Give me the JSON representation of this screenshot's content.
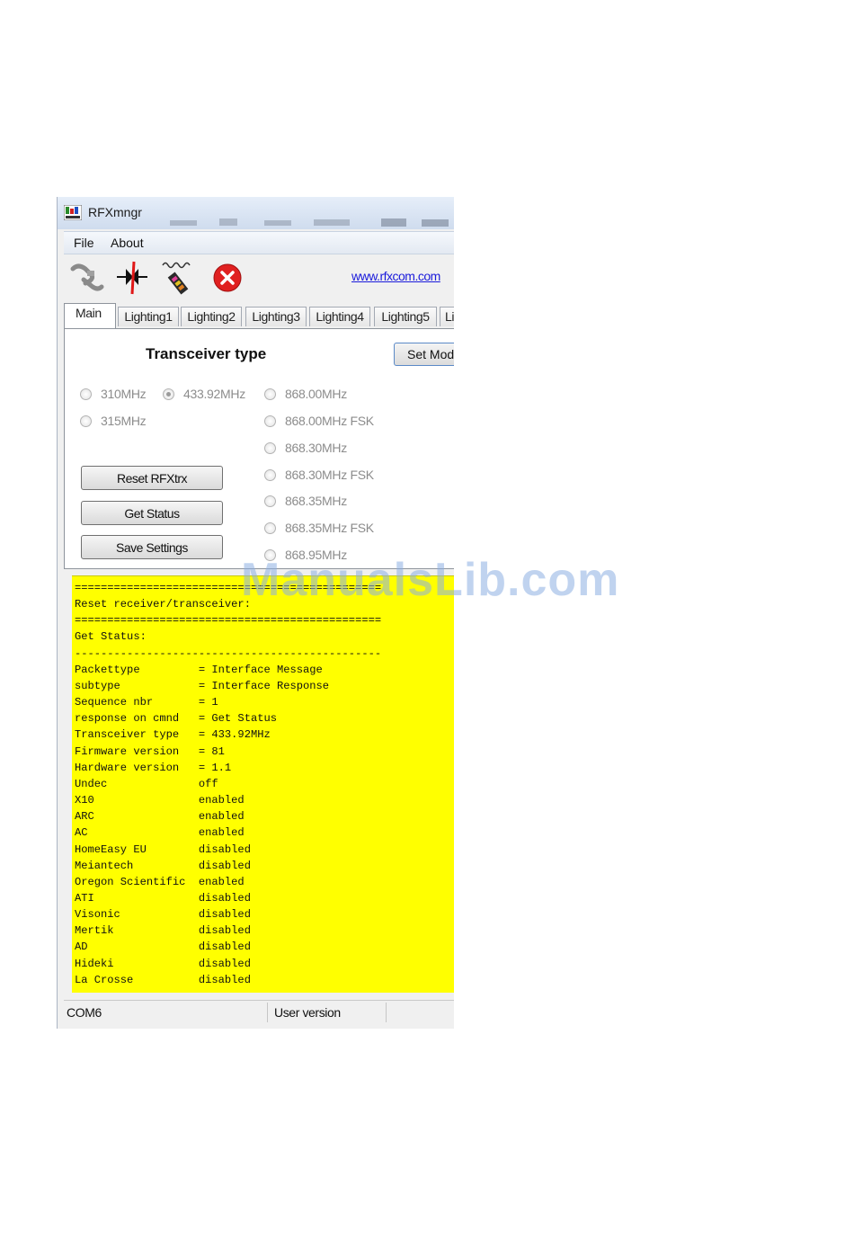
{
  "window": {
    "title": "RFXmngr"
  },
  "menu": {
    "file": "File",
    "about": "About"
  },
  "toolbar": {
    "buttons": [
      {
        "icon": "connect-plug-icon"
      },
      {
        "icon": "disconnect-icon"
      },
      {
        "icon": "sniffer-probe-icon"
      },
      {
        "icon": "close-red-x-icon"
      }
    ],
    "link": "www.rfxcom.com"
  },
  "tabs": [
    "Main",
    "Lighting1",
    "Lighting2",
    "Lighting3",
    "Lighting4",
    "Lighting5",
    "Li"
  ],
  "main": {
    "transceiver_title": "Transceiver type",
    "set_mode_label": "Set Mod",
    "radios": [
      {
        "label": "310MHz",
        "checked": false
      },
      {
        "label": "433.92MHz",
        "checked": true
      },
      {
        "label": "868.00MHz",
        "checked": false
      },
      {
        "label": "315MHz",
        "checked": false
      },
      {
        "label": "868.00MHz FSK",
        "checked": false
      },
      {
        "label": "868.30MHz",
        "checked": false
      },
      {
        "label": "868.30MHz FSK",
        "checked": false
      },
      {
        "label": "868.35MHz",
        "checked": false
      },
      {
        "label": "868.35MHz FSK",
        "checked": false
      },
      {
        "label": "868.95MHz",
        "checked": false
      }
    ],
    "buttons": {
      "reset": "Reset RFXtrx",
      "status": "Get Status",
      "save": "Save Settings"
    }
  },
  "console": {
    "lines": [
      "===============================================",
      "Reset receiver/transceiver:",
      "===============================================",
      "Get Status:",
      "-----------------------------------------------",
      "Packettype         = Interface Message",
      "subtype            = Interface Response",
      "Sequence nbr       = 1",
      "response on cmnd   = Get Status",
      "Transceiver type   = 433.92MHz",
      "Firmware version   = 81",
      "Hardware version   = 1.1",
      "Undec              off",
      "X10                enabled",
      "ARC                enabled",
      "AC                 enabled",
      "HomeEasy EU        disabled",
      "Meiantech          disabled",
      "Oregon Scientific  enabled",
      "ATI                disabled",
      "Visonic            disabled",
      "Mertik             disabled",
      "AD                 disabled",
      "Hideki             disabled",
      "La Crosse          disabled"
    ]
  },
  "status": {
    "port": "COM6",
    "version": "User version"
  },
  "watermark": "ManualsLib.com",
  "colors": {
    "console_bg": "#ffff00",
    "link": "#1a1adb",
    "close_red": "#e02020"
  }
}
